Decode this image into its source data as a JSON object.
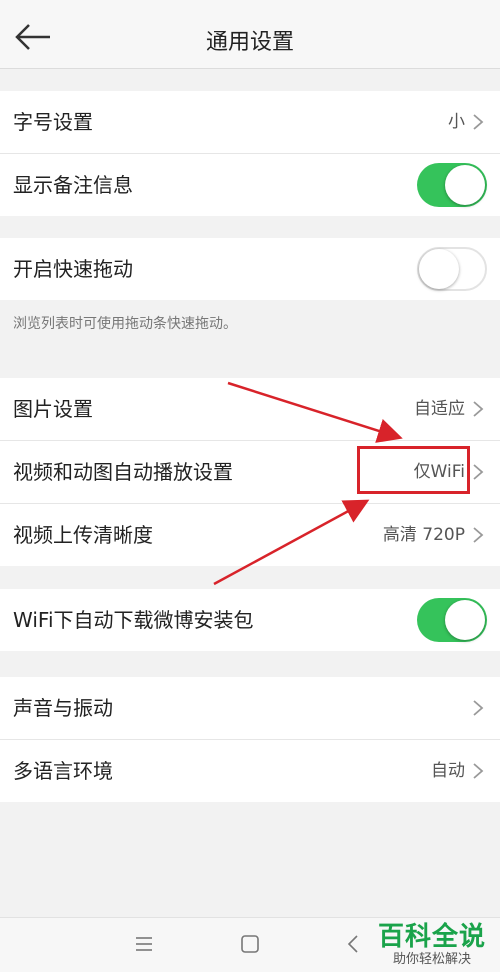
{
  "header": {
    "title": "通用设置"
  },
  "groups": [
    {
      "rows": [
        {
          "label": "字号设置",
          "value": "小"
        },
        {
          "label": "显示备注信息",
          "toggle": "on"
        }
      ]
    },
    {
      "rows": [
        {
          "label": "开启快速拖动",
          "toggle": "off"
        }
      ],
      "hint": "浏览列表时可使用拖动条快速拖动。"
    },
    {
      "rows": [
        {
          "label": "图片设置",
          "value": "自适应"
        },
        {
          "label": "视频和动图自动播放设置",
          "value": "仅WiFi"
        },
        {
          "label": "视频上传清晰度",
          "value": "高清 720P"
        }
      ]
    },
    {
      "rows": [
        {
          "label": "WiFi下自动下载微博安装包",
          "toggle": "on"
        }
      ]
    },
    {
      "rows": [
        {
          "label": "声音与振动",
          "value": ""
        },
        {
          "label": "多语言环境",
          "value": "自动"
        }
      ]
    }
  ],
  "annotation": {
    "color": "#d8232a"
  },
  "colors": {
    "toggle_on": "#35c35b",
    "accent_red": "#d8232a",
    "watermark_green": "#1aa34a"
  },
  "nav_icons": [
    "menu-icon",
    "home-square-icon",
    "back-triangle-icon"
  ],
  "watermark": {
    "title": "百科全说",
    "subtitle": "助你轻松解决"
  }
}
